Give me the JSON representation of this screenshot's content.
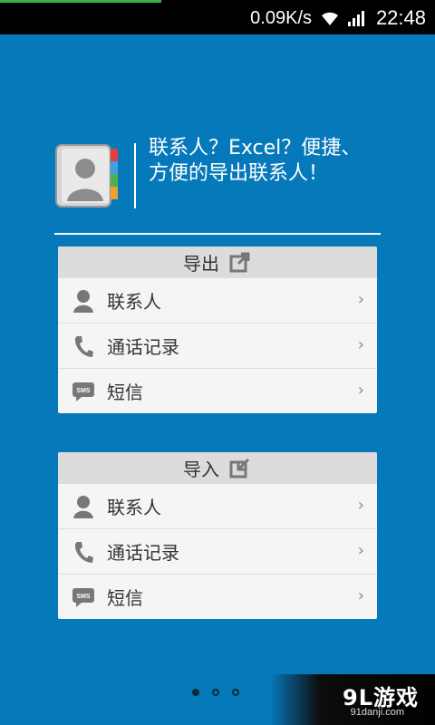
{
  "status_bar": {
    "net_speed": "0.09K/s",
    "time": "22:48"
  },
  "header": {
    "icon": "contacts-book-icon",
    "tagline": "联系人？Excel？便捷、方便的导出联系人！"
  },
  "export_card": {
    "title": "导出",
    "title_icon": "export-icon",
    "items": [
      {
        "label": "联系人",
        "icon": "person-icon"
      },
      {
        "label": "通话记录",
        "icon": "phone-icon"
      },
      {
        "label": "短信",
        "icon": "sms-icon"
      }
    ]
  },
  "import_card": {
    "title": "导入",
    "title_icon": "import-icon",
    "items": [
      {
        "label": "联系人",
        "icon": "person-icon"
      },
      {
        "label": "通话记录",
        "icon": "phone-icon"
      },
      {
        "label": "短信",
        "icon": "sms-icon"
      }
    ]
  },
  "pager": {
    "pages": 3,
    "current": 1
  },
  "watermark": {
    "logo_text": "9L游戏",
    "site": "91danji.com"
  },
  "colors": {
    "background": "#0679bb",
    "status_bar": "#000000",
    "card": "#f5f5f5",
    "card_header": "#dcdcdc"
  }
}
